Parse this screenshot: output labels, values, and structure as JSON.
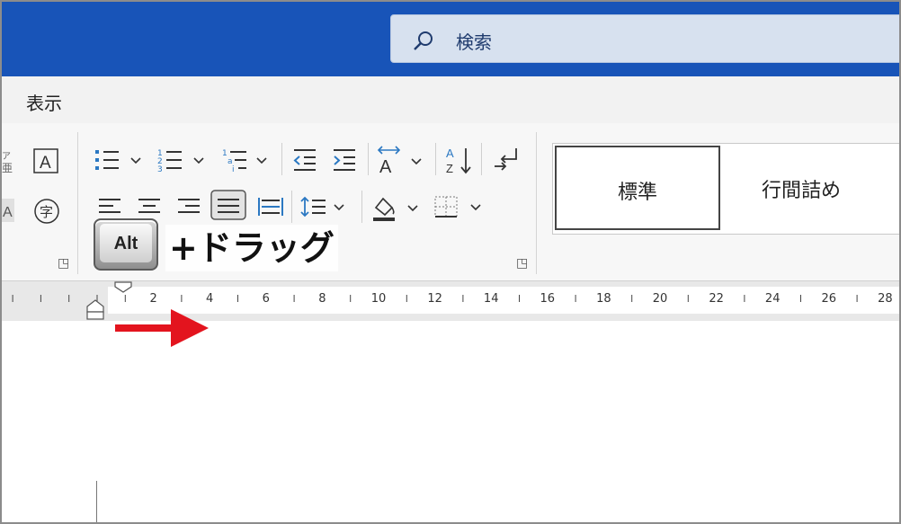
{
  "search": {
    "placeholder": "検索"
  },
  "menu": {
    "tab_view": "表示"
  },
  "styles": {
    "normal": "標準",
    "no_spacing": "行間詰め"
  },
  "ruler": {
    "labels": [
      "2",
      "4",
      "6",
      "8",
      "10",
      "12",
      "14",
      "16",
      "18",
      "20",
      "22",
      "24",
      "26",
      "28"
    ]
  },
  "overlay": {
    "key_label": "Alt",
    "instruction": "+ドラッグ"
  },
  "icons": {
    "search": "magnifier-icon",
    "bullets": "bullet-list-icon",
    "numbering": "numbered-list-icon",
    "multilevel": "multilevel-list-icon",
    "decrease_indent": "decrease-indent-icon",
    "increase_indent": "increase-indent-icon",
    "char_spacing": "character-spacing-icon",
    "sort": "sort-icon",
    "show_marks": "paragraph-mark-icon",
    "align_left": "align-left-icon",
    "center": "align-center-icon",
    "align_right": "align-right-icon",
    "justify": "justify-icon",
    "distribute": "distributed-icon",
    "line_spacing": "line-spacing-icon",
    "shading": "shading-icon",
    "borders": "borders-icon",
    "enclosed_char": "enclosed-character-icon",
    "ruby": "character-border-icon"
  },
  "colors": {
    "titlebar": "#1854b8",
    "accent": "#2b78c2",
    "arrow": "#e3141e"
  }
}
